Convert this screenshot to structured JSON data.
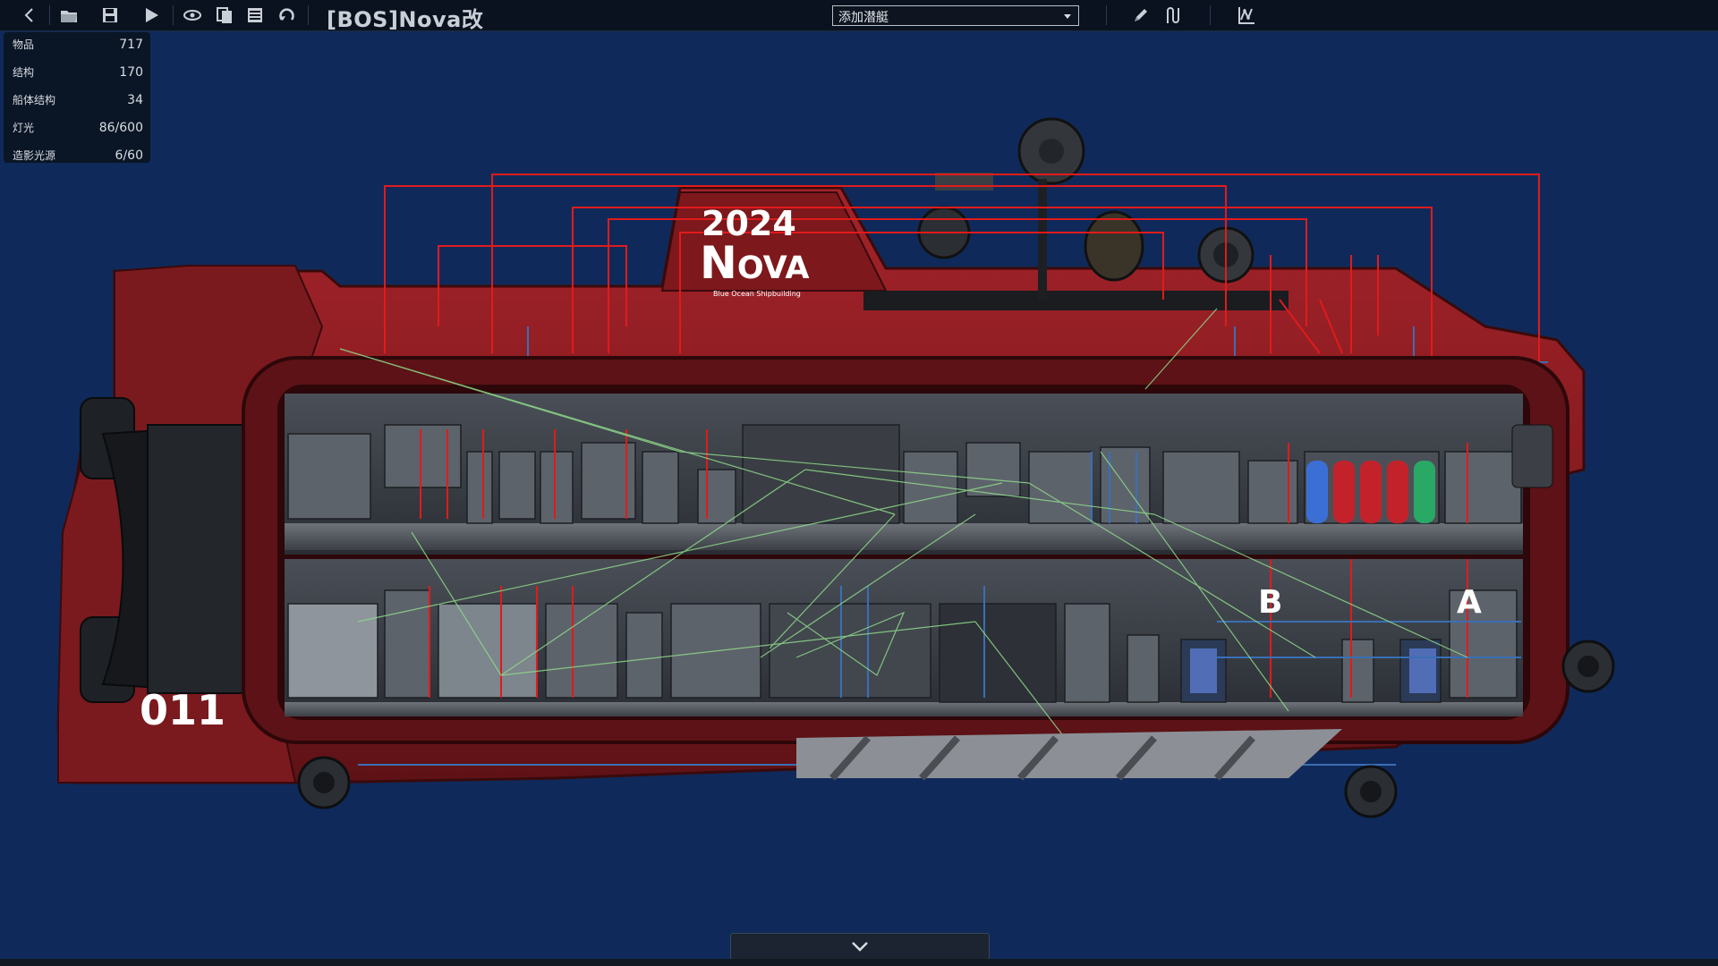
{
  "toolbar": {
    "title": "[BOS]Nova改",
    "add_sub_dropdown": "添加潜艇",
    "icons": [
      "back-icon",
      "open-folder-icon",
      "save-icon",
      "play-icon",
      "visibility-icon",
      "layers-icon",
      "list-icon",
      "undo-icon",
      "pencil-icon",
      "wire-icon",
      "graph-icon"
    ]
  },
  "stats": [
    {
      "label": "物品",
      "value": "717"
    },
    {
      "label": "结构",
      "value": "170"
    },
    {
      "label": "船体结构",
      "value": "34"
    },
    {
      "label": "灯光",
      "value": "86/600"
    },
    {
      "label": "造影光源",
      "value": "6/60"
    }
  ],
  "submarine": {
    "year": "2024",
    "name": "Nova",
    "builder": "Blue Ocean Shipbuilding",
    "hull_number": "011",
    "markers": [
      "B",
      "A"
    ]
  },
  "colors": {
    "background": "#0f2a5a",
    "hull": "#8b1d20",
    "wire_red": "#e01b1b",
    "wire_blue": "#3a6fb5",
    "wire_green": "#8fd98a"
  }
}
